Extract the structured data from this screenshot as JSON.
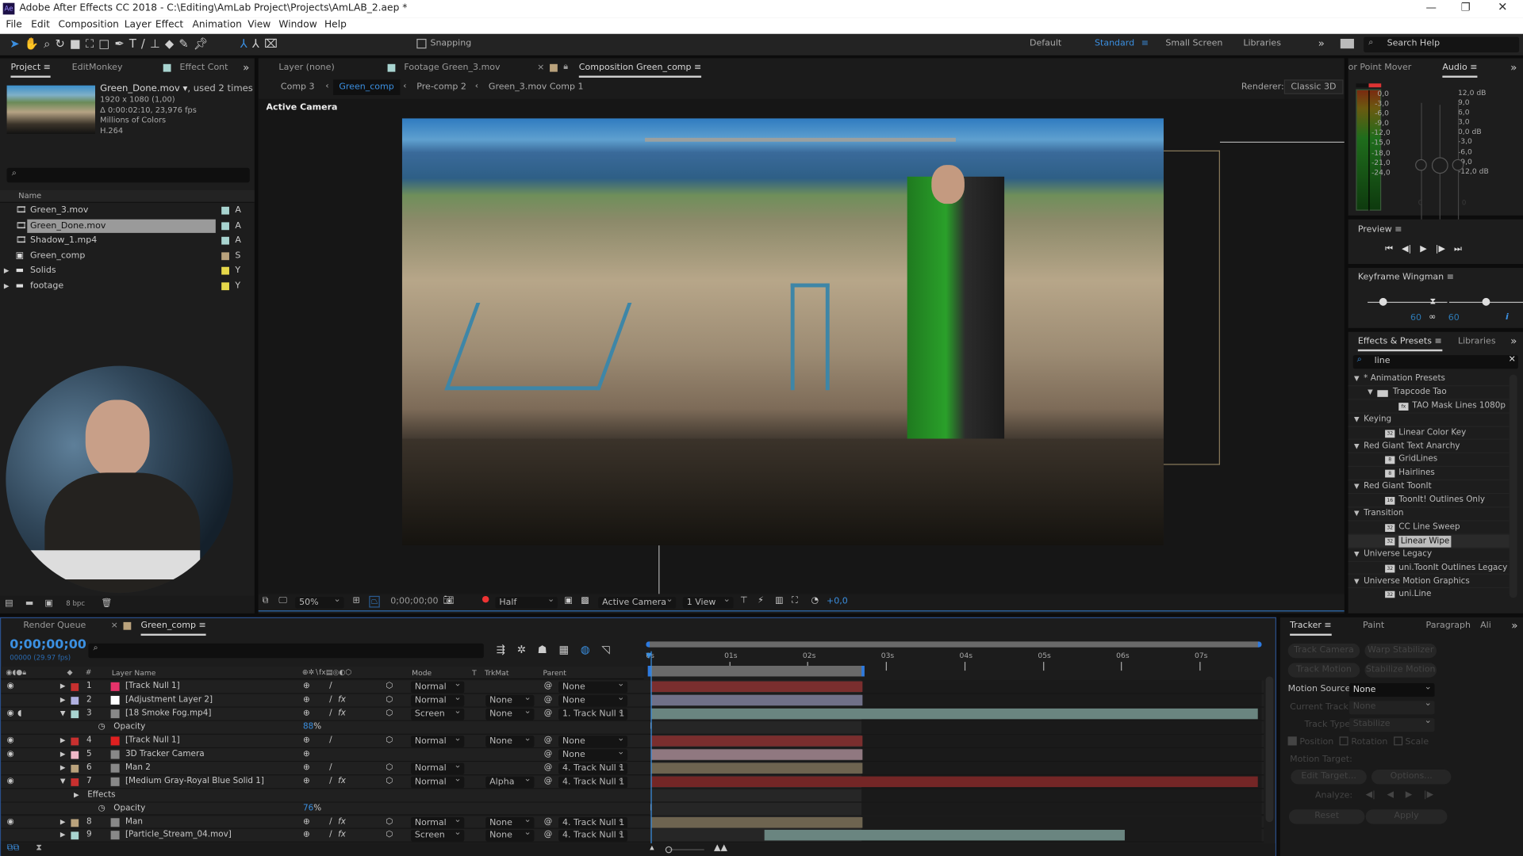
{
  "window": {
    "title": "Adobe After Effects CC 2018 - C:\\Editing\\AmLab Project\\Projects\\AmLAB_2.aep *",
    "app_icon": "Ae"
  },
  "menu": [
    "File",
    "Edit",
    "Composition",
    "Layer",
    "Effect",
    "Animation",
    "View",
    "Window",
    "Help"
  ],
  "toolbar": {
    "snapping": "Snapping",
    "workspaces": [
      "Default",
      "Standard",
      "Small Screen",
      "Libraries"
    ],
    "active_workspace": "Standard",
    "search_placeholder": "Search Help"
  },
  "project": {
    "tabs": [
      "Project",
      "EditMonkey",
      "Effect Cont"
    ],
    "selected_name": "Green_Done.mov",
    "used": ", used 2 times",
    "info": [
      "1920 x 1080 (1,00)",
      "Δ 0:00:02:10, 23,976 fps",
      "Millions of Colors",
      "H.264"
    ],
    "col_name": "Name",
    "items": [
      {
        "name": "Green_3.mov",
        "type": "footage",
        "label": "A",
        "color": "#a8d4d0"
      },
      {
        "name": "Green_Done.mov",
        "type": "footage",
        "label": "A",
        "color": "#a8d4d0",
        "selected": true
      },
      {
        "name": "Shadow_1.mp4",
        "type": "footage",
        "label": "A",
        "color": "#a8d4d0"
      },
      {
        "name": "Green_comp",
        "type": "comp",
        "label": "S",
        "color": "#b9a27c"
      },
      {
        "name": "Solids",
        "type": "folder",
        "label": "Y",
        "color": "#e6d84a"
      },
      {
        "name": "footage",
        "type": "folder",
        "label": "Y",
        "color": "#e6d84a"
      }
    ],
    "bpc": "8 bpc"
  },
  "viewer": {
    "tabs": [
      "Layer (none)",
      "Footage Green_3.mov",
      "Composition Green_comp"
    ],
    "breadcrumbs": [
      "Comp 3",
      "Green_comp",
      "Pre-comp 2",
      "Green_3.mov Comp 1"
    ],
    "active_crumb": "Green_comp",
    "renderer_label": "Renderer:",
    "renderer": "Classic 3D",
    "camera_label": "Active Camera",
    "zoom": "50%",
    "timecode": "0;00;00;00",
    "resolution": "Half",
    "camera": "Active Camera",
    "views": "1 View",
    "exposure": "+0,0"
  },
  "audio": {
    "tabs": [
      "or Point Mover",
      "Audio"
    ],
    "left_scale": [
      "0,0",
      "-3,0",
      "-6,0",
      "-9,0",
      "-12,0",
      "-15,0",
      "-18,0",
      "-21,0",
      "-24,0"
    ],
    "right_scale": [
      "12,0 dB",
      "9,0",
      "6,0",
      "3,0",
      "0,0 dB",
      "-3,0",
      "-6,0",
      "-9,0",
      "-12,0 dB"
    ],
    "knob_values": [
      "0",
      "0"
    ]
  },
  "preview": {
    "title": "Preview"
  },
  "wingman": {
    "title": "Keyframe Wingman",
    "left": "60",
    "right": "60"
  },
  "effects": {
    "tabs": [
      "Effects & Presets",
      "Libraries"
    ],
    "search": "line",
    "tree": [
      {
        "text": "* Animation Presets",
        "level": 0,
        "kind": "group"
      },
      {
        "text": "Trapcode Tao",
        "level": 1,
        "kind": "folder"
      },
      {
        "text": "TAO Mask Lines 1080p",
        "level": 2,
        "kind": "preset"
      },
      {
        "text": "Keying",
        "level": 0,
        "kind": "group"
      },
      {
        "text": "Linear Color Key",
        "level": 1,
        "kind": "effect",
        "badge": "32"
      },
      {
        "text": "Red Giant Text Anarchy",
        "level": 0,
        "kind": "group"
      },
      {
        "text": "GridLines",
        "level": 1,
        "kind": "effect",
        "badge": "8"
      },
      {
        "text": "Hairlines",
        "level": 1,
        "kind": "effect",
        "badge": "8"
      },
      {
        "text": "Red Giant ToonIt",
        "level": 0,
        "kind": "group"
      },
      {
        "text": "ToonIt! Outlines Only",
        "level": 1,
        "kind": "effect",
        "badge": "16"
      },
      {
        "text": "Transition",
        "level": 0,
        "kind": "group"
      },
      {
        "text": "CC Line Sweep",
        "level": 1,
        "kind": "effect",
        "badge": "32"
      },
      {
        "text": "Linear Wipe",
        "level": 1,
        "kind": "effect",
        "badge": "32",
        "selected": true
      },
      {
        "text": "Universe Legacy",
        "level": 0,
        "kind": "group"
      },
      {
        "text": "uni.ToonIt Outlines Legacy",
        "level": 1,
        "kind": "effect",
        "badge": "32"
      },
      {
        "text": "Universe Motion Graphics",
        "level": 0,
        "kind": "group"
      },
      {
        "text": "uni.Line",
        "level": 1,
        "kind": "effect",
        "badge": "32"
      }
    ]
  },
  "timeline": {
    "tabs": [
      "Render Queue",
      "Green_comp"
    ],
    "timecode": "0;00;00;00",
    "frames": "00000 (29.97 fps)",
    "headers": {
      "name": "Layer Name",
      "mode": "Mode",
      "t": "T",
      "trkmat": "TrkMat",
      "parent": "Parent"
    },
    "ruler": [
      "0s",
      "01s",
      "02s",
      "03s",
      "04s",
      "05s",
      "06s",
      "07s"
    ],
    "rows": [
      {
        "kind": "layer",
        "num": "1",
        "name": "[Track Null 1]",
        "label": "#c8302f",
        "swatch": "#e8336b",
        "eye": true,
        "mode": "Normal",
        "trkmat": "",
        "parent": "None",
        "bar": [
          0,
          2.7
        ],
        "bar_color": "#7a2e2e",
        "fx": false
      },
      {
        "kind": "layer",
        "num": "2",
        "name": "[Adjustment Layer 2]",
        "label": "#b0b0e0",
        "swatch": "#ffffff",
        "eye": false,
        "mode": "Normal",
        "trkmat": "None",
        "parent": "None",
        "bar": [
          0,
          2.7
        ],
        "bar_color": "#707088",
        "fx": true
      },
      {
        "kind": "layer",
        "num": "3",
        "name": "[18 Smoke Fog.mp4]",
        "label": "#a8d4d0",
        "eye": true,
        "audio": true,
        "expanded": true,
        "mode": "Screen",
        "trkmat": "None",
        "parent": "1. Track Null 1",
        "bar": [
          0,
          7.8
        ],
        "bar_color": "#6a8580",
        "fx": true
      },
      {
        "kind": "prop",
        "name": "Opacity",
        "value": "88",
        "unit": "%"
      },
      {
        "kind": "layer",
        "num": "4",
        "name": "[Track Null 1]",
        "label": "#c8302f",
        "swatch": "#e02020",
        "eye": true,
        "mode": "Normal",
        "trkmat": "None",
        "parent": "None",
        "bar": [
          0,
          2.7
        ],
        "bar_color": "#7a2e2e",
        "fx": false
      },
      {
        "kind": "layer",
        "num": "5",
        "name": "3D Tracker Camera",
        "label": "#f0b8c8",
        "eye": true,
        "mode": "",
        "trkmat": "",
        "parent": "None",
        "bar": [
          0,
          2.7
        ],
        "bar_color": "#907880",
        "fx": false
      },
      {
        "kind": "layer",
        "num": "6",
        "name": "Man 2",
        "label": "#b9a27c",
        "eye": false,
        "mode": "Normal",
        "trkmat": "",
        "parent": "4. Track Null 1",
        "bar": [
          0,
          2.7
        ],
        "bar_color": "#6e6450",
        "fx": false
      },
      {
        "kind": "layer",
        "num": "7",
        "name": "[Medium Gray-Royal Blue Solid 1]",
        "label": "#c8302f",
        "eye": true,
        "expanded": true,
        "mode": "Normal",
        "trkmat": "Alpha",
        "parent": "4. Track Null 1",
        "bar": [
          0,
          7.8
        ],
        "bar_color": "#742626",
        "fx": true
      },
      {
        "kind": "group",
        "name": "Effects"
      },
      {
        "kind": "prop",
        "name": "Opacity",
        "value": "76",
        "unit": "%"
      },
      {
        "kind": "layer",
        "num": "8",
        "name": "Man",
        "label": "#b9a27c",
        "eye": true,
        "mode": "Normal",
        "trkmat": "None",
        "parent": "4. Track Null 1",
        "bar": [
          0,
          2.7
        ],
        "bar_color": "#6e6450",
        "fx": true
      },
      {
        "kind": "layer",
        "num": "9",
        "name": "[Particle_Stream_04.mov]",
        "label": "#a8d4d0",
        "eye": false,
        "mode": "Screen",
        "trkmat": "None",
        "parent": "4. Track Null 1",
        "bar": [
          1.45,
          6.05
        ],
        "bar_color": "#6a8580",
        "fx": true
      }
    ]
  },
  "tracker": {
    "tabs": [
      "Tracker",
      "Paint",
      "Paragraph",
      "Ali"
    ],
    "buttons": [
      "Track Camera",
      "Warp Stabilizer",
      "Track Motion",
      "Stabilize Motion"
    ],
    "motion_source_label": "Motion Source:",
    "motion_source": "None",
    "current_track_label": "Current Track:",
    "current_track": "None",
    "track_type_label": "Track Type:",
    "track_type": "Stabilize",
    "checks": [
      {
        "label": "Position",
        "checked": true
      },
      {
        "label": "Rotation",
        "checked": false
      },
      {
        "label": "Scale",
        "checked": false
      }
    ],
    "motion_target_label": "Motion Target:",
    "edit_target": "Edit Target...",
    "options": "Options...",
    "analyze_label": "Analyze:",
    "reset": "Reset",
    "apply": "Apply"
  }
}
